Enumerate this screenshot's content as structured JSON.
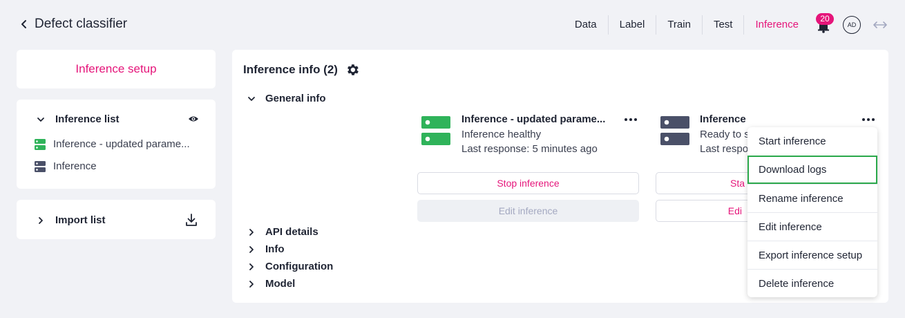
{
  "header": {
    "title": "Defect classifier",
    "nav": [
      "Data",
      "Label",
      "Train",
      "Test",
      "Inference"
    ],
    "active_nav": "Inference",
    "notification_count": "20",
    "avatar_initials": "AD"
  },
  "sidebar": {
    "setup_label": "Inference setup",
    "list_title": "Inference list",
    "items": [
      {
        "label": "Inference - updated parame...",
        "status_color": "#2fb35a"
      },
      {
        "label": "Inference",
        "status_color": "#4a5068"
      }
    ],
    "import_title": "Import list"
  },
  "main": {
    "title": "Inference info (2)",
    "sections": {
      "general": "General info",
      "api": "API details",
      "info": "Info",
      "configuration": "Configuration",
      "model": "Model"
    },
    "cards": [
      {
        "name": "Inference - updated parame...",
        "status": "Inference healthy",
        "last_response": "Last response: 5 minutes ago",
        "primary_button": "Stop inference",
        "secondary_button": "Edit inference",
        "color": "#2fb35a"
      },
      {
        "name": "Inference",
        "status": "Ready to s",
        "last_response": "Last respo",
        "primary_button": "Sta",
        "secondary_button": "Edi",
        "color": "#4a5068"
      }
    ]
  },
  "context_menu": {
    "items": [
      "Start inference",
      "Download logs",
      "Rename inference",
      "Edit inference",
      "Export inference setup",
      "Delete inference"
    ],
    "highlighted": "Download logs"
  },
  "colors": {
    "accent": "#e5157a",
    "healthy": "#2fb35a",
    "idle": "#4a5068",
    "highlight_border": "#2aa84a"
  }
}
